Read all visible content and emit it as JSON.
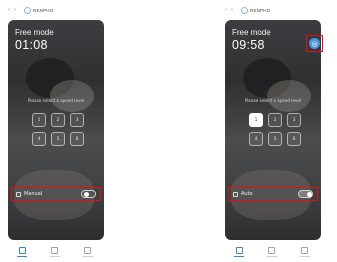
{
  "left_phone": {
    "header": {
      "brand": "RENPHO"
    },
    "mode_title": "Free mode",
    "timer": "01:08",
    "hint": "Please select a speed level",
    "levels": [
      "1",
      "2",
      "3",
      "4",
      "5",
      "6"
    ],
    "active_level": null,
    "mode_label": "Manual",
    "toggle_state": "off"
  },
  "right_phone": {
    "header": {
      "brand": "RENPHO"
    },
    "mode_title": "Free mode",
    "timer": "09:58",
    "hint": "Please select a speed level",
    "levels": [
      "1",
      "2",
      "3",
      "4",
      "5",
      "6"
    ],
    "active_level": "1",
    "mode_label": "Auto",
    "toggle_state": "on"
  },
  "colors": {
    "highlight_box": "#e01010",
    "accent_blue": "#4d97d8"
  },
  "icons": [
    "back-arrow-icon",
    "forward-arrow-icon",
    "brand-logo-icon",
    "auto-mode-icon",
    "mode-icon",
    "home-tab-icon",
    "folder-tab-icon",
    "stats-tab-icon"
  ]
}
